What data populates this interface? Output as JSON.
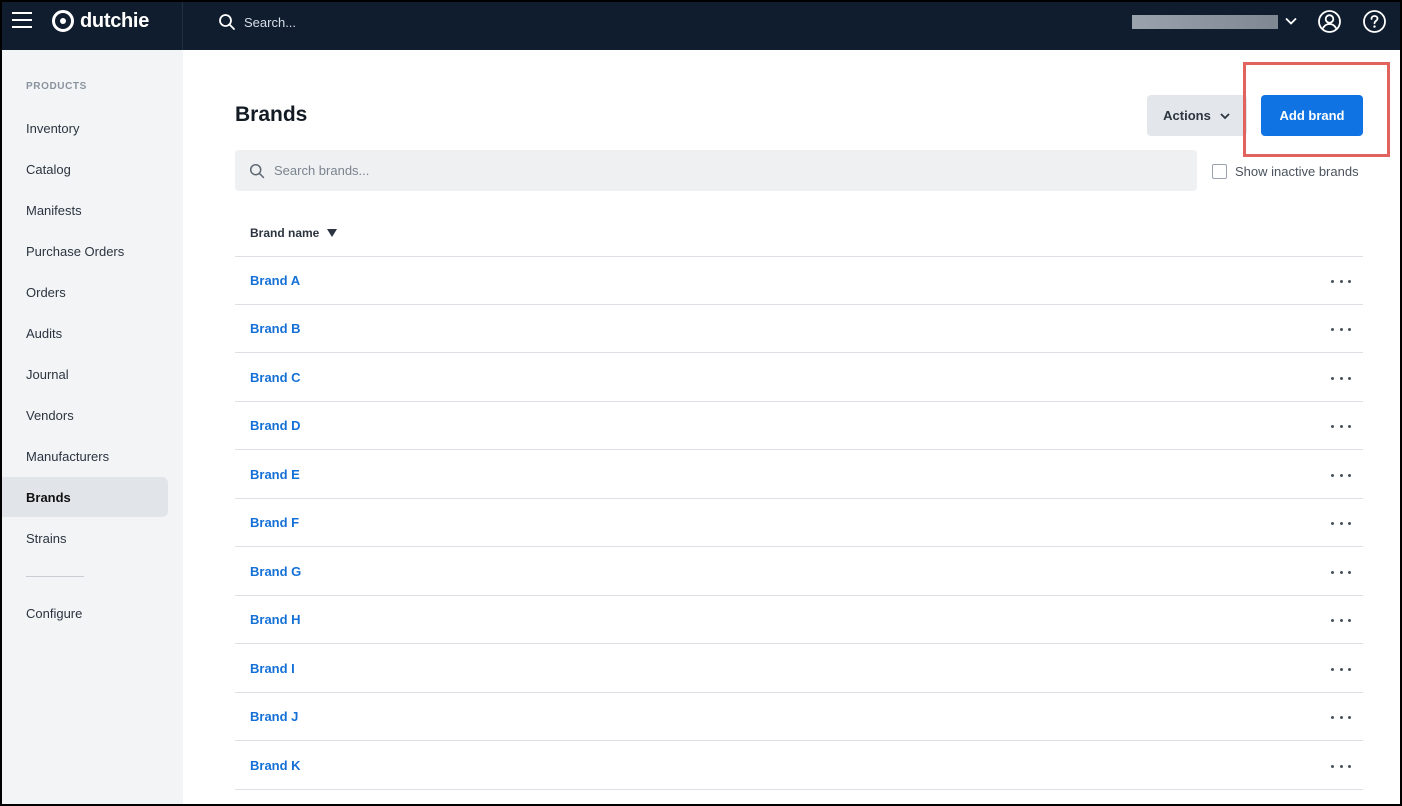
{
  "topbar": {
    "logo": "dutchie",
    "search_placeholder": "Search..."
  },
  "sidebar": {
    "heading": "PRODUCTS",
    "items": [
      {
        "label": "Inventory"
      },
      {
        "label": "Catalog"
      },
      {
        "label": "Manifests"
      },
      {
        "label": "Purchase Orders"
      },
      {
        "label": "Orders"
      },
      {
        "label": "Audits"
      },
      {
        "label": "Journal"
      },
      {
        "label": "Vendors"
      },
      {
        "label": "Manufacturers"
      },
      {
        "label": "Brands",
        "active": true
      },
      {
        "label": "Strains"
      }
    ],
    "configure": "Configure"
  },
  "main": {
    "title": "Brands",
    "actions_label": "Actions",
    "add_label": "Add brand",
    "search_placeholder": "Search brands...",
    "inactive_label": "Show inactive brands",
    "column_header": "Brand name",
    "rows": [
      {
        "name": "Brand A"
      },
      {
        "name": "Brand B"
      },
      {
        "name": "Brand C"
      },
      {
        "name": "Brand D"
      },
      {
        "name": "Brand E"
      },
      {
        "name": "Brand F"
      },
      {
        "name": "Brand G"
      },
      {
        "name": "Brand H"
      },
      {
        "name": "Brand I"
      },
      {
        "name": "Brand J"
      },
      {
        "name": "Brand K"
      }
    ]
  },
  "colors": {
    "topbar": "#0f1d2e",
    "primary": "#0f73e3",
    "link": "#1470d6",
    "highlight": "#e2625e"
  }
}
